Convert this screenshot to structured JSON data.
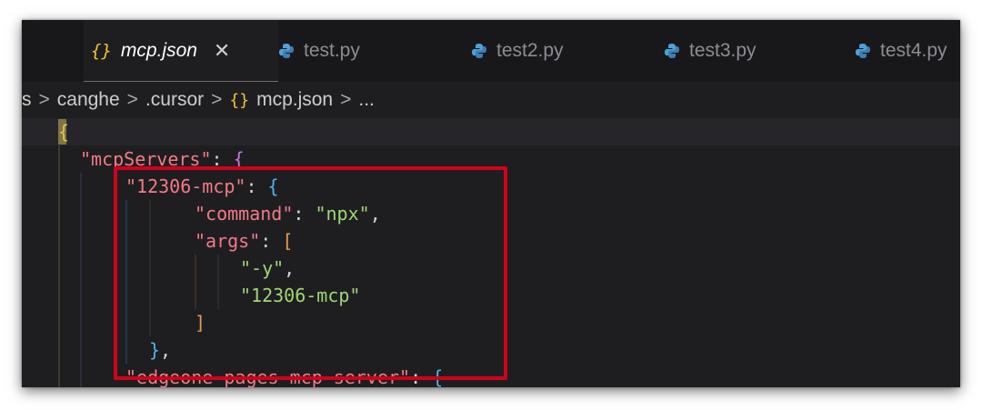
{
  "tabs": [
    {
      "label": "mcp.json",
      "icon": "braces-icon",
      "active": true,
      "close": "✕"
    },
    {
      "label": "test.py",
      "icon": "python-icon",
      "active": false
    },
    {
      "label": "test2.py",
      "icon": "python-icon",
      "active": false
    },
    {
      "label": "test3.py",
      "icon": "python-icon",
      "active": false
    },
    {
      "label": "test4.py",
      "icon": "python-icon",
      "active": false
    }
  ],
  "breadcrumb": {
    "items": [
      "s",
      "canghe",
      ".cursor",
      "mcp.json",
      "..."
    ],
    "separator": ">",
    "file_icon": "{}"
  },
  "code": {
    "line1": {
      "open": "{"
    },
    "line2": {
      "key": "\"mcpServers\"",
      "colon": ": ",
      "open": "{"
    },
    "line3": {
      "key": "\"12306-mcp\"",
      "colon": ": ",
      "open": "{"
    },
    "line4": {
      "key": "\"command\"",
      "colon": ": ",
      "value": "\"npx\"",
      "comma": ","
    },
    "line5": {
      "key": "\"args\"",
      "colon": ": ",
      "open": "["
    },
    "line6": {
      "value": "\"-y\"",
      "comma": ","
    },
    "line7": {
      "value": "\"12306-mcp\""
    },
    "line8": {
      "close": "]"
    },
    "line9": {
      "close": "}",
      "comma": ","
    },
    "line10": {
      "key": "\"edgeone-pages-mcp-server\"",
      "colon": ": ",
      "open": "{"
    }
  },
  "colors": {
    "highlight": "#d0021b",
    "json_key": "#f47a83",
    "json_string": "#9ed774",
    "brace_icon": "#f0c531"
  }
}
